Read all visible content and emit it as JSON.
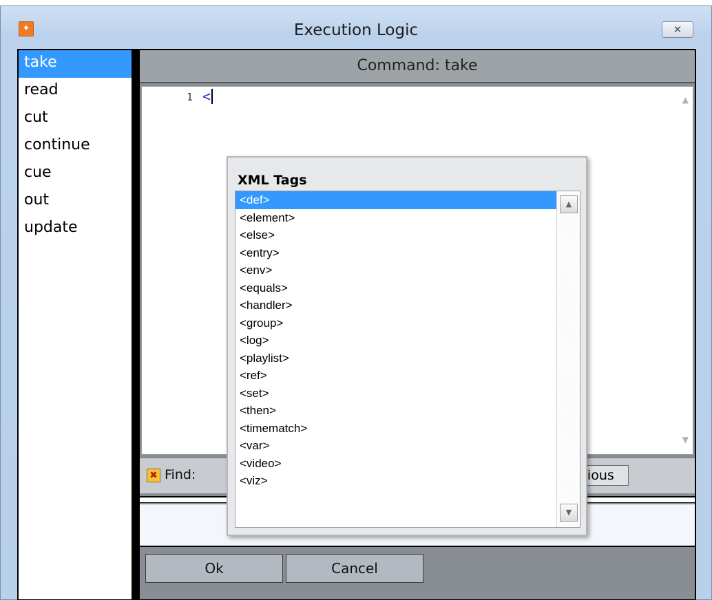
{
  "window": {
    "title": "Execution Logic",
    "close_glyph": "✕"
  },
  "commands": [
    {
      "label": "take",
      "selected": true
    },
    {
      "label": "read",
      "selected": false
    },
    {
      "label": "cut",
      "selected": false
    },
    {
      "label": "continue",
      "selected": false
    },
    {
      "label": "cue",
      "selected": false
    },
    {
      "label": "out",
      "selected": false
    },
    {
      "label": "update",
      "selected": false
    }
  ],
  "header": {
    "title": "Command: take"
  },
  "editor": {
    "line_number": "1",
    "code": "<"
  },
  "popup": {
    "title": "XML Tags",
    "tags": [
      "<def>",
      "<element>",
      "<else>",
      "<entry>",
      "<env>",
      "<equals>",
      "<handler>",
      "<group>",
      "<log>",
      "<playlist>",
      "<ref>",
      "<set>",
      "<then>",
      "<timematch>",
      "<var>",
      "<video>",
      "<viz>"
    ]
  },
  "find": {
    "label": "Find:",
    "previous_label": "evious"
  },
  "buttons": {
    "ok": "Ok",
    "cancel": "Cancel"
  }
}
